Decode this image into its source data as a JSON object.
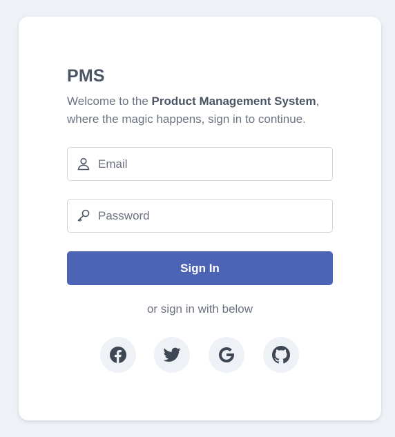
{
  "app": {
    "title": "PMS",
    "intro_prefix": "Welcome to the ",
    "intro_emphasis": "Product Management System",
    "intro_suffix": ", where the magic happens, sign in to continue."
  },
  "form": {
    "email_placeholder": "Email",
    "email_value": "",
    "password_placeholder": "Password",
    "password_value": "",
    "submit_label": "Sign In"
  },
  "social": {
    "prompt": "or sign in with below",
    "providers": [
      {
        "id": "facebook",
        "icon": "facebook-icon"
      },
      {
        "id": "twitter",
        "icon": "twitter-icon"
      },
      {
        "id": "google",
        "icon": "google-icon"
      },
      {
        "id": "github",
        "icon": "github-icon"
      }
    ]
  },
  "colors": {
    "page_background": "#eef2f7",
    "card_background": "#ffffff",
    "primary_button": "#4c63b6",
    "heading_text": "#4b5563",
    "body_text": "#6b7280",
    "icon_color": "#3f4654",
    "social_button_background": "#eef2f7"
  }
}
